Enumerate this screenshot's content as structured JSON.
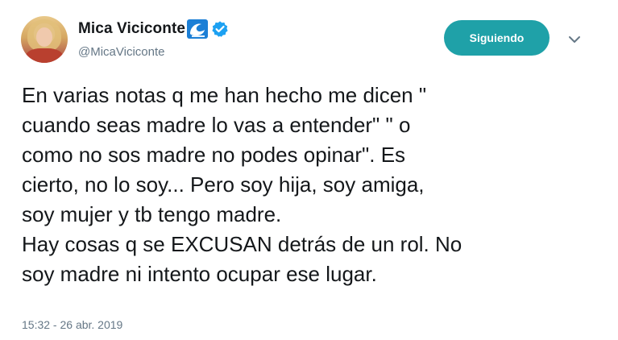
{
  "user": {
    "display_name": "Mica Viciconte",
    "handle": "@MicaViciconte",
    "name_emoji_icon": "water-wave-icon",
    "verified_icon": "verified-badge-icon"
  },
  "actions": {
    "follow_label": "Siguiendo",
    "menu_icon": "chevron-down-icon"
  },
  "tweet": {
    "lines": [
      "En varias notas q me han hecho me dicen \"",
      "cuando seas madre lo vas a entender\" \" o",
      "como no sos madre no podes opinar\". Es",
      "cierto, no lo soy... Pero soy hija, soy amiga,",
      "soy mujer y tb tengo madre.",
      "Hay cosas q se EXCUSAN detrás de un rol. No",
      "soy madre ni intento ocupar ese lugar."
    ],
    "timestamp": "15:32 - 26 abr. 2019"
  },
  "colors": {
    "follow_button": "#1fa1a8",
    "verified": "#1da1f2",
    "secondary_text": "#657786",
    "primary_text": "#14171a"
  }
}
